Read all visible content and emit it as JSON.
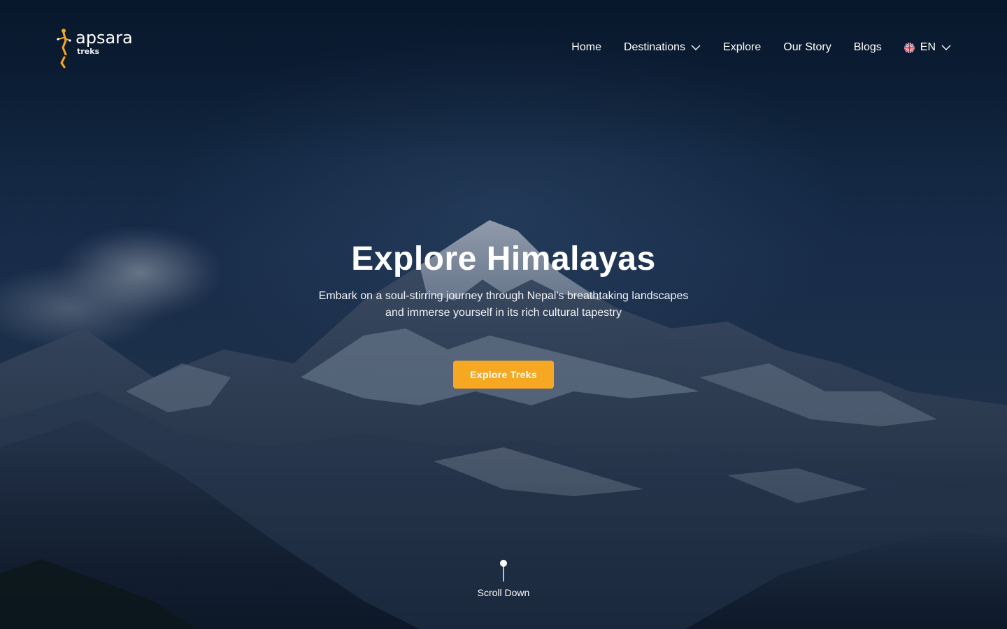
{
  "brand": {
    "name": "apsara",
    "tagline": "treks"
  },
  "nav": {
    "items": [
      {
        "label": "Home"
      },
      {
        "label": "Destinations",
        "has_dropdown": true
      },
      {
        "label": "Explore"
      },
      {
        "label": "Our Story"
      },
      {
        "label": "Blogs"
      }
    ],
    "language": {
      "label": "EN",
      "flag_icon": "uk-flag-icon",
      "has_dropdown": true
    }
  },
  "hero": {
    "title": "Explore Himalayas",
    "subtitle": "Embark on a soul-stirring journey through Nepal's breathtaking landscapes and immerse yourself in its rich cultural tapestry",
    "cta_label": "Explore Treks",
    "scroll_label": "Scroll Down"
  },
  "colors": {
    "accent": "#f7a823",
    "overlay": "#0b1d35",
    "text": "#ffffff"
  }
}
